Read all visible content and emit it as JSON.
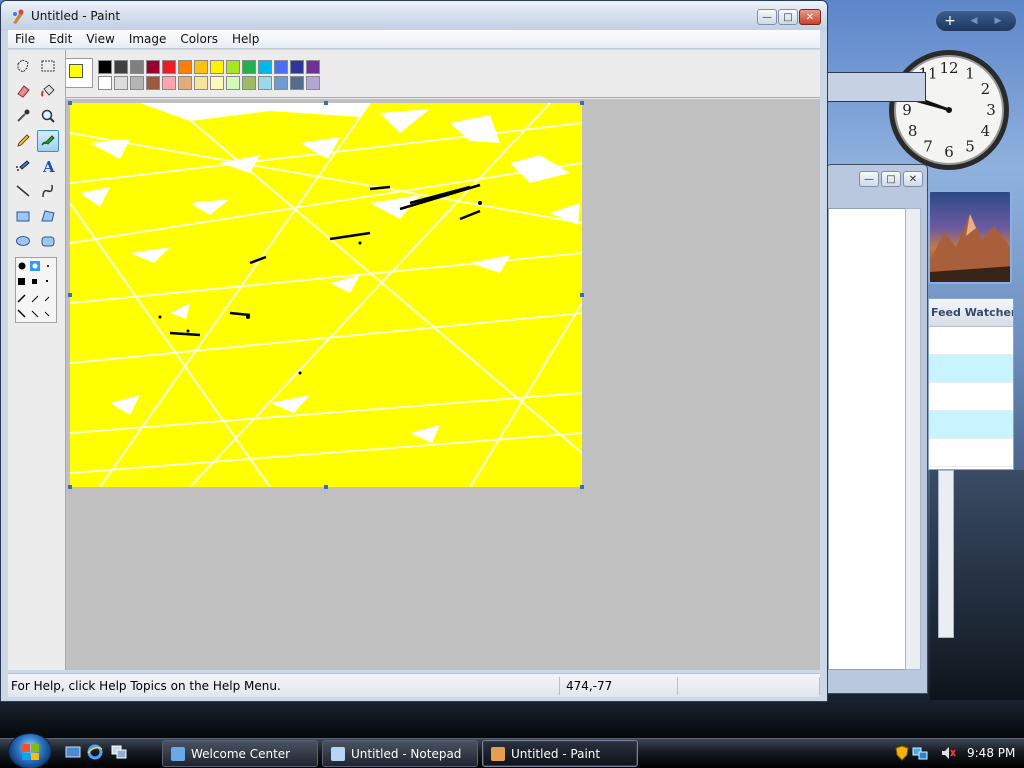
{
  "window": {
    "title": "Untitled - Paint",
    "buttons": {
      "minimize": "—",
      "maximize": "□",
      "close": "✕"
    }
  },
  "menu": [
    "File",
    "Edit",
    "View",
    "Image",
    "Colors",
    "Help"
  ],
  "palette": {
    "foreground": "#ffff00",
    "colors_row1": [
      "#000000",
      "#404040",
      "#808080",
      "#990030",
      "#ed1c24",
      "#ff7e00",
      "#ffc20e",
      "#fff200",
      "#a8e61d",
      "#22b14c",
      "#00b7ef",
      "#4d6df3",
      "#2f3699",
      "#6f3198"
    ],
    "colors_row2": [
      "#ffffff",
      "#dcdcdc",
      "#b4b4b4",
      "#9c5a3c",
      "#ffa3b1",
      "#e5aa7a",
      "#f5e49c",
      "#fff9bd",
      "#d3f9bc",
      "#9dbb61",
      "#99d9ea",
      "#709ad1",
      "#546d8e",
      "#b5a5d5"
    ]
  },
  "tools": [
    {
      "name": "free-select-icon",
      "row": 0,
      "col": 0
    },
    {
      "name": "rect-select-icon",
      "row": 0,
      "col": 1
    },
    {
      "name": "eraser-icon",
      "row": 1,
      "col": 0
    },
    {
      "name": "fill-bucket-icon",
      "row": 1,
      "col": 1
    },
    {
      "name": "color-picker-icon",
      "row": 2,
      "col": 0
    },
    {
      "name": "magnifier-icon",
      "row": 2,
      "col": 1
    },
    {
      "name": "pencil-icon",
      "row": 3,
      "col": 0
    },
    {
      "name": "brush-icon",
      "row": 3,
      "col": 1
    },
    {
      "name": "airbrush-icon",
      "row": 4,
      "col": 0
    },
    {
      "name": "text-icon",
      "row": 4,
      "col": 1
    },
    {
      "name": "line-icon",
      "row": 5,
      "col": 0
    },
    {
      "name": "curve-icon",
      "row": 5,
      "col": 1
    },
    {
      "name": "rectangle-icon",
      "row": 6,
      "col": 0
    },
    {
      "name": "polygon-icon",
      "row": 6,
      "col": 1
    },
    {
      "name": "ellipse-icon",
      "row": 7,
      "col": 0
    },
    {
      "name": "rounded-rect-icon",
      "row": 7,
      "col": 1
    }
  ],
  "active_tool": "brush-icon",
  "status": {
    "help": "For Help, click Help Topics on the Help Menu.",
    "coords": "474,-77"
  },
  "gadgets": {
    "feed_title": "Feed Watcher",
    "clock_numbers": [
      "12",
      "1",
      "2",
      "3",
      "4",
      "5",
      "6",
      "7",
      "8",
      "9",
      "10",
      "11"
    ],
    "gadget_add": "+",
    "gadget_prev": "◀",
    "gadget_next": "▶"
  },
  "taskbar": {
    "buttons": [
      {
        "label": "Welcome Center",
        "active": false
      },
      {
        "label": "Untitled - Notepad",
        "active": false
      },
      {
        "label": "Untitled - Paint",
        "active": true
      }
    ],
    "time": "9:48 PM"
  }
}
